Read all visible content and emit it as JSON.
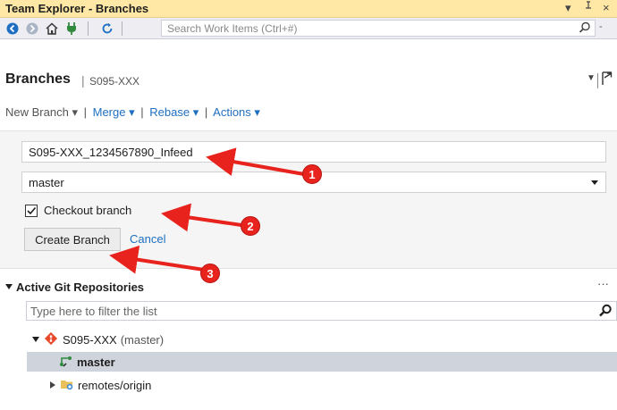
{
  "window": {
    "title": "Team Explorer - Branches",
    "pin_glyph": "▾",
    "autohide_glyph": "⊥",
    "close_glyph": "×"
  },
  "toolbar": {
    "icons": [
      "back-icon",
      "forward-icon",
      "home-icon",
      "connect-plug-icon",
      "refresh-icon"
    ],
    "search_placeholder": "Search Work Items (Ctrl+#)"
  },
  "header": {
    "page_title": "Branches",
    "separator": "|",
    "repo_name": "S095-XXX"
  },
  "actions": {
    "new_branch": "New Branch",
    "merge": "Merge",
    "rebase": "Rebase",
    "actions": "Actions",
    "caret": "▾",
    "separator": "|"
  },
  "create_form": {
    "branch_name_value": "S095-XXX_1234567890_Infeed",
    "source_branch": "master",
    "checkout_checked": true,
    "checkout_label": "Checkout branch",
    "create_button": "Create Branch",
    "cancel_link": "Cancel"
  },
  "repositories": {
    "section_title": "Active Git Repositories",
    "more_glyph": "···",
    "filter_placeholder": "Type here to filter the list",
    "repo": {
      "name": "S095-XXX",
      "current_branch_label": "(master)"
    },
    "branches": [
      {
        "label": "master",
        "selected": true
      }
    ],
    "remotes_label": "remotes/origin"
  },
  "annotations": {
    "badges": [
      "1",
      "2",
      "3"
    ],
    "color": "#e8221c"
  },
  "colors": {
    "title_bar": "#ffe8a6",
    "link": "#1e6fc1",
    "selected_row": "#cfd3db",
    "panel": "#f5f5f5"
  }
}
